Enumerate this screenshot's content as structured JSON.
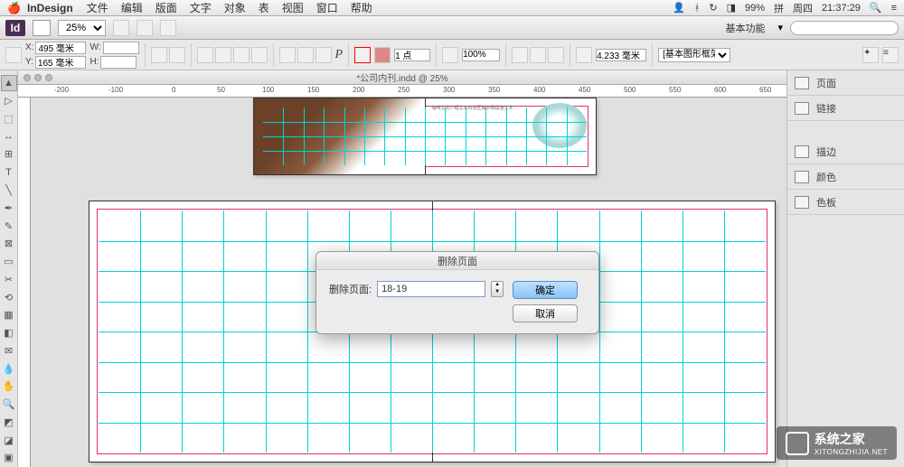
{
  "menubar": {
    "app_name": "InDesign",
    "items": [
      "文件",
      "编辑",
      "版面",
      "文字",
      "对象",
      "表",
      "视图",
      "窗口",
      "帮助"
    ],
    "battery": "99%",
    "ime": "拼",
    "day": "周四",
    "time": "21:37:29"
  },
  "appbar": {
    "zoom": "25%",
    "workspace": "基本功能"
  },
  "controlbar": {
    "x_label": "X:",
    "y_label": "Y:",
    "w_label": "W:",
    "h_label": "H:",
    "x_value": "495 毫米",
    "y_value": "165 毫米",
    "stroke_label": "1 点",
    "opacity": "100%",
    "dim_value": "4.233 毫米",
    "frame_style": "[基本图形框架]"
  },
  "document": {
    "title": "*公司内刊.indd @ 25%"
  },
  "ruler_marks": [
    "-200",
    "-100",
    "0",
    "50",
    "100",
    "150",
    "200",
    "250",
    "300",
    "350",
    "400",
    "450",
    "500",
    "550",
    "600",
    "650"
  ],
  "panels": {
    "items": [
      "页面",
      "链接",
      "描边",
      "颜色",
      "色板"
    ]
  },
  "dialog": {
    "title": "删除页面",
    "field_label": "删除页面:",
    "field_value": "18-19",
    "ok": "确定",
    "cancel": "取消"
  },
  "watermark": {
    "name": "系统之家",
    "url": "XITONGZHIJIA.NET"
  }
}
